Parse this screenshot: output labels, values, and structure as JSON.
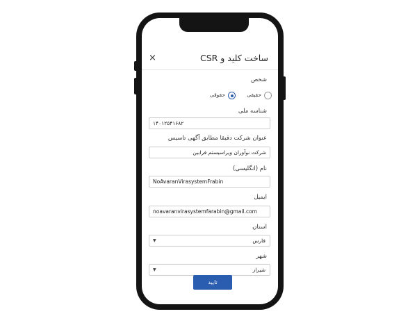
{
  "dialog": {
    "title": "ساخت کلید و CSR",
    "close_glyph": "×"
  },
  "form": {
    "person_label": "شخص",
    "person_options": [
      {
        "label": "حقیقی",
        "checked": false
      },
      {
        "label": "حقوقی",
        "checked": true
      }
    ],
    "national_id_label": "شناسه ملی",
    "national_id_value": "۱۴۰۱۲۵۴۱۶۸۲",
    "company_title_label": "عنوان شرکت دقیقا مطابق آگهی تاسیس",
    "company_title_value": "شرکت نوآوران ویراسیستم فرابین",
    "english_name_label": "نام (انگلیسی)",
    "english_name_value": "NoAvaranVirasystemFrabin",
    "email_label": "ایمیل",
    "email_value": "noavaranvirasystemfarabin@gmail.com",
    "province_label": "استان",
    "province_value": "فارس",
    "city_label": "شهر",
    "city_value": "شیراز",
    "dropdown_glyph": "▼"
  },
  "actions": {
    "confirm_label": "تایید"
  },
  "colors": {
    "accent": "#2a5db0",
    "phone_frame": "#141414"
  }
}
